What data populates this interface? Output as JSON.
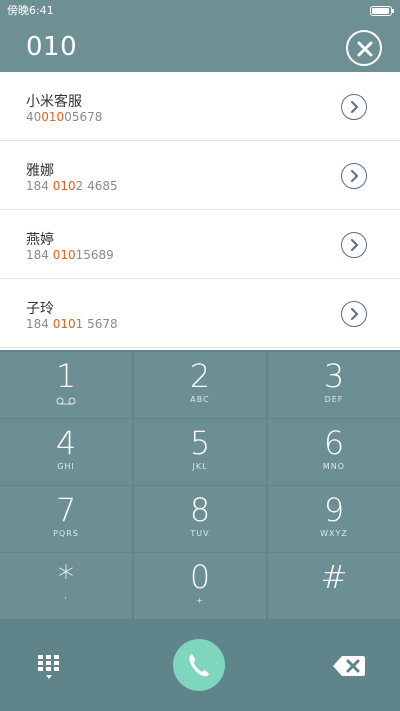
{
  "status": {
    "time": "傍晚6:41"
  },
  "dialer": {
    "number": "010"
  },
  "results": [
    {
      "name": "小米客服",
      "number_parts": [
        "40",
        "010",
        "05678"
      ]
    },
    {
      "name": "雅娜",
      "number_parts": [
        "184 ",
        "010",
        "2 4685"
      ]
    },
    {
      "name": "燕婷",
      "number_parts": [
        "184 ",
        "010",
        "15689"
      ]
    },
    {
      "name": "子玲",
      "number_parts": [
        "184 ",
        "010",
        "1 5678"
      ]
    }
  ],
  "keys": [
    {
      "digit": "1",
      "letters": ""
    },
    {
      "digit": "2",
      "letters": "ABC"
    },
    {
      "digit": "3",
      "letters": "DEF"
    },
    {
      "digit": "4",
      "letters": "GHI"
    },
    {
      "digit": "5",
      "letters": "JKL"
    },
    {
      "digit": "6",
      "letters": "MNO"
    },
    {
      "digit": "7",
      "letters": "PQRS"
    },
    {
      "digit": "8",
      "letters": "TUV"
    },
    {
      "digit": "9",
      "letters": "WXYZ"
    },
    {
      "digit": "*",
      "letters": "'"
    },
    {
      "digit": "0",
      "letters": "+"
    },
    {
      "digit": "#",
      "letters": ""
    }
  ],
  "colors": {
    "accent": "#e0631c",
    "call": "#7ed6bf",
    "header": "#6c9094",
    "keypad": "#6b8f93"
  },
  "icons": {
    "clear": "close-icon",
    "detail": "chevron-right-icon",
    "voicemail": "voicemail-icon",
    "keypad_toggle": "grid-icon",
    "call": "phone-icon",
    "backspace": "backspace-icon"
  }
}
